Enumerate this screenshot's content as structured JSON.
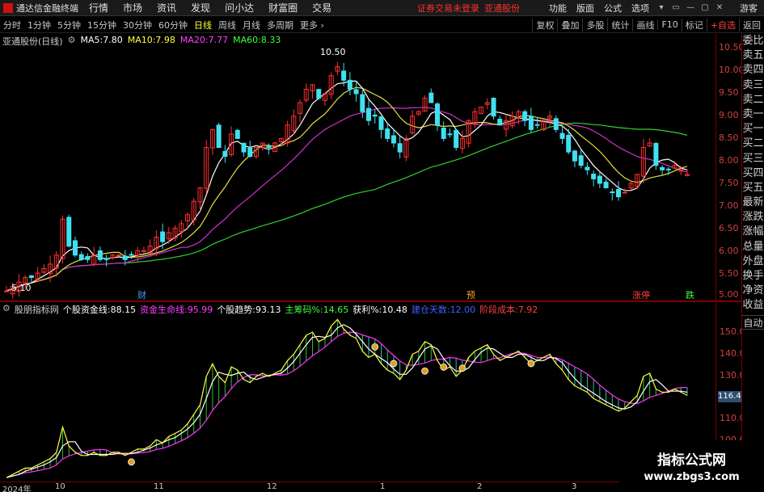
{
  "app": {
    "title": "通达信金融终端",
    "status": "证券交易未登录",
    "stock": "亚通股份",
    "guest": "游客"
  },
  "menu": [
    "行情",
    "市场",
    "资讯",
    "发现",
    "问小达",
    "财富圈",
    "交易"
  ],
  "menu_right": [
    "功能",
    "版面",
    "公式",
    "选项"
  ],
  "window_buttons": [
    "▾",
    "▭",
    "—",
    "▢",
    "✕"
  ],
  "toolbar": {
    "periods": [
      "分时",
      "1分钟",
      "5分钟",
      "15分钟",
      "30分钟",
      "60分钟",
      "日线",
      "周线",
      "月线",
      "多周期",
      "更多"
    ],
    "active": "日线",
    "right": [
      "复权",
      "叠加",
      "多股",
      "统计",
      "画线",
      "F10",
      "标记",
      "+自选",
      "返回"
    ]
  },
  "main_legend": {
    "title": "亚通股份(日线)",
    "ma": [
      {
        "label": "MA5:",
        "value": "7.80",
        "color": "#ffffff"
      },
      {
        "label": "MA10:",
        "value": "7.98",
        "color": "#ffff40"
      },
      {
        "label": "MA20:",
        "value": "7.77",
        "color": "#ff40ff"
      },
      {
        "label": "MA60:",
        "value": "8.33",
        "color": "#40ff40"
      }
    ]
  },
  "price_axis": [
    "10.50",
    "10.00",
    "9.50",
    "9.00",
    "8.50",
    "8.00",
    "7.50",
    "7.00",
    "6.50",
    "6.00",
    "5.50",
    "5.00"
  ],
  "annotations": {
    "high": "10.50",
    "low": "5.10"
  },
  "markers": [
    {
      "text": "财",
      "color": "#40a0ff"
    },
    {
      "text": "预",
      "color": "#ffa020"
    },
    {
      "text": "涨停",
      "color": "#ff4040"
    },
    {
      "text": "跌",
      "color": "#40ff40"
    }
  ],
  "indicator_legend": {
    "name": "股朋指标网",
    "items": [
      {
        "label": "个股资金线:",
        "value": "88.15",
        "color": "#ffffff"
      },
      {
        "label": "资金生命线:",
        "value": "95.99",
        "color": "#ff40ff"
      },
      {
        "label": "个股趋势:",
        "value": "93.13",
        "color": "#ffffff"
      },
      {
        "label": "主筹码%:",
        "value": "14.65",
        "color": "#40ff40"
      },
      {
        "label": "获利%:",
        "value": "10.48",
        "color": "#ffffff"
      },
      {
        "label": "建仓天数:",
        "value": "12.00",
        "color": "#4060ff"
      },
      {
        "label": "阶段成本:",
        "value": "7.92",
        "color": "#ff4040"
      }
    ]
  },
  "indicator_axis": [
    "150.0",
    "140.0",
    "130.0",
    "120.0",
    "110.0",
    "100.0"
  ],
  "indicator_current": "116.46",
  "right_panel": [
    "委比",
    "卖五",
    "卖四",
    "卖三",
    "卖二",
    "卖一",
    "买一",
    "买二",
    "买三",
    "买四",
    "买五",
    "最新",
    "涨跌",
    "涨幅",
    "总量",
    "外盘",
    "换手",
    "净资",
    "收益"
  ],
  "right_panel_auto": "自动",
  "date_axis": [
    "2024年",
    "10",
    "11",
    "12",
    "1",
    "2",
    "3"
  ],
  "watermark": {
    "title": "指标公式网",
    "url": "www.zbgs3.com"
  },
  "chart_data": {
    "type": "candlestick",
    "close": [
      5.2,
      5.3,
      5.4,
      5.5,
      5.5,
      5.6,
      5.7,
      5.8,
      6.0,
      6.8,
      6.2,
      6.0,
      5.9,
      5.9,
      6.0,
      5.9,
      5.9,
      6.0,
      6.0,
      5.9,
      6.0,
      6.1,
      6.1,
      6.2,
      6.4,
      6.3,
      6.5,
      6.6,
      6.7,
      6.9,
      7.2,
      7.5,
      8.4,
      8.8,
      8.4,
      8.2,
      8.7,
      8.6,
      8.3,
      8.2,
      8.4,
      8.5,
      8.4,
      8.5,
      8.6,
      8.9,
      9.1,
      9.4,
      9.7,
      9.8,
      9.5,
      9.6,
      10.0,
      10.2,
      9.9,
      9.7,
      9.6,
      9.2,
      9.0,
      9.1,
      8.8,
      8.6,
      8.5,
      8.3,
      8.6,
      9.1,
      9.2,
      9.5,
      9.4,
      8.9,
      8.6,
      8.7,
      8.4,
      8.6,
      9.0,
      9.2,
      9.3,
      9.4,
      9.1,
      8.9,
      9.0,
      9.1,
      9.2,
      9.0,
      8.8,
      8.9,
      9.0,
      9.1,
      8.8,
      8.6,
      8.3,
      8.1,
      8.0,
      7.9,
      7.7,
      7.6,
      7.5,
      7.4,
      7.3,
      7.4,
      7.6,
      7.8,
      8.4,
      8.5,
      8.0,
      7.9,
      7.9,
      8.0,
      7.9,
      7.8
    ],
    "ma60_last": 8.33,
    "indicator": {
      "price_line_last": 88.15,
      "life_line_last": 95.99,
      "trend_last": 93.13
    }
  }
}
